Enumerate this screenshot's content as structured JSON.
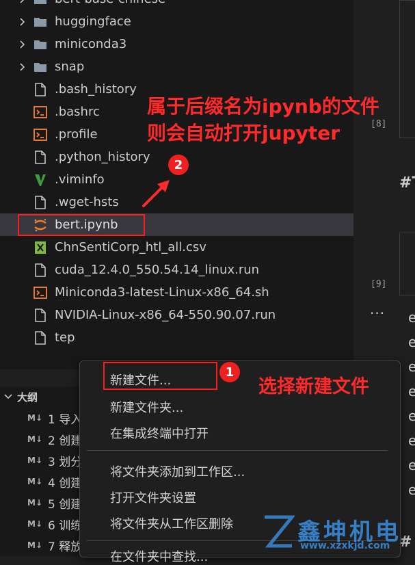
{
  "explorer": {
    "partial_top_item": "bert-base-chinese",
    "items": [
      {
        "label": "huggingface",
        "kind": "folder",
        "icon": "folder-icon"
      },
      {
        "label": "miniconda3",
        "kind": "folder",
        "icon": "folder-icon"
      },
      {
        "label": "snap",
        "kind": "folder",
        "icon": "folder-icon"
      },
      {
        "label": ".bash_history",
        "kind": "file",
        "icon": "file-icon"
      },
      {
        "label": ".bashrc",
        "kind": "shell",
        "icon": "terminal-file-icon"
      },
      {
        "label": ".profile",
        "kind": "shell",
        "icon": "terminal-file-icon"
      },
      {
        "label": ".python_history",
        "kind": "file",
        "icon": "file-icon"
      },
      {
        "label": ".viminfo",
        "kind": "vim",
        "icon": "vim-icon"
      },
      {
        "label": ".wget-hsts",
        "kind": "file",
        "icon": "file-icon"
      },
      {
        "label": "bert.ipynb",
        "kind": "jupyter",
        "icon": "jupyter-icon",
        "selected": true
      },
      {
        "label": "ChnSentiCorp_htl_all.csv",
        "kind": "csv",
        "icon": "csv-icon"
      },
      {
        "label": "cuda_12.4.0_550.54.14_linux.run",
        "kind": "file",
        "icon": "file-icon"
      },
      {
        "label": "Miniconda3-latest-Linux-x86_64.sh",
        "kind": "shell",
        "icon": "terminal-file-icon"
      },
      {
        "label": "NVIDIA-Linux-x86_64-550.90.07.run",
        "kind": "file",
        "icon": "file-icon"
      },
      {
        "label": "tep",
        "kind": "file",
        "icon": "file-icon"
      }
    ]
  },
  "annotations": {
    "top_line1": "属于后缀名为ipynb的文件",
    "top_line2": "则会自动打开jupyter",
    "badge1": "1",
    "badge2": "2",
    "menu_hint": "选择新建文件"
  },
  "outline": {
    "title": "大纲",
    "md_tag": "M↓",
    "items": [
      "1 导入",
      "2 创建",
      "3 划分",
      "4 创建",
      "5 创建",
      "6 训练",
      "7 释放"
    ]
  },
  "context_menu": {
    "items": [
      "新建文件...",
      "新建文件夹...",
      "在集成终端中打开",
      "将文件夹添加到工作区...",
      "打开文件夹设置",
      "将文件夹从工作区删除",
      "在文件夹中查找..."
    ]
  },
  "notebook": {
    "cell_nums": [
      "[8]",
      "[9]"
    ],
    "heading_fragment": "#T",
    "bottom_fragment": "#",
    "output_letters": [
      "e",
      "e",
      "e",
      "e",
      "e",
      "e",
      "e",
      "e"
    ],
    "ellipsis": "···"
  },
  "watermark": {
    "brand": "鑫坤机电",
    "url": "www.xzxkjd.com"
  },
  "colors": {
    "annotation_red": "#ff2a2a",
    "folder": "#8a9aa8",
    "shell": "#e37933",
    "vim": "#3f9d3f",
    "csv": "#7fba3c",
    "jupyter": "#f37726",
    "watermark": "#3a8ad6"
  }
}
